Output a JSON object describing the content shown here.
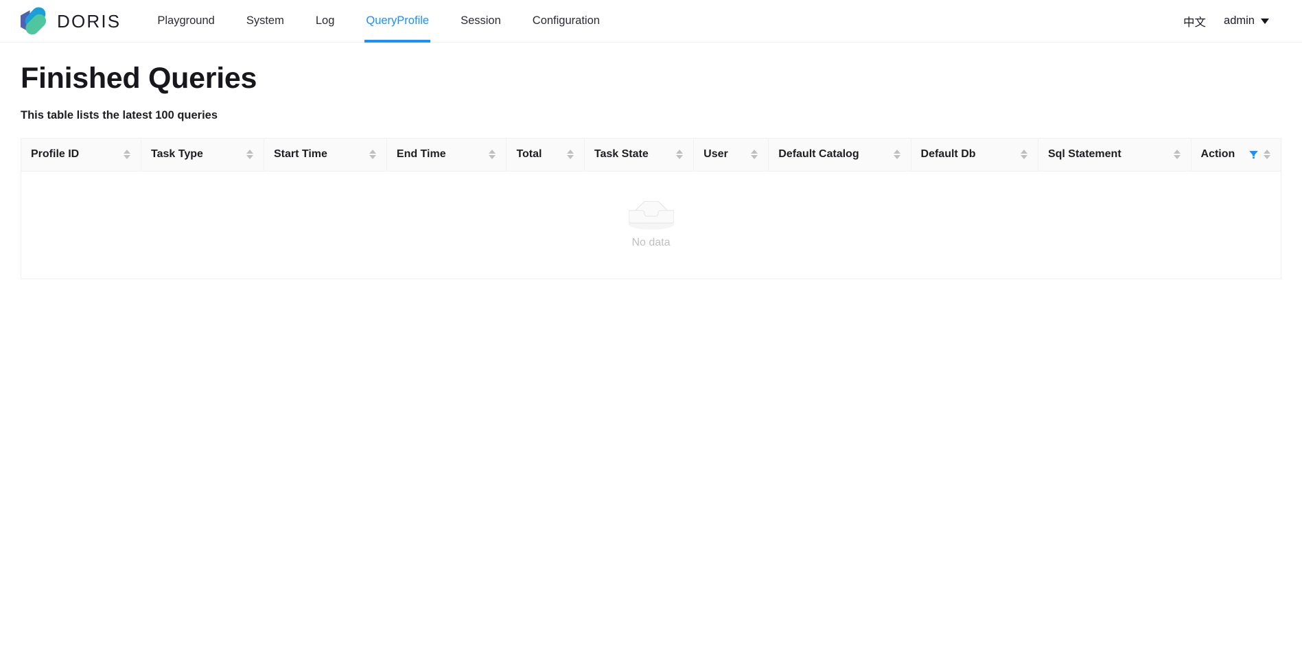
{
  "header": {
    "brand": {
      "name": "DORIS",
      "logo_icon": "doris-logo-icon"
    },
    "nav": [
      {
        "label": "Playground",
        "active": false
      },
      {
        "label": "System",
        "active": false
      },
      {
        "label": "Log",
        "active": false
      },
      {
        "label": "QueryProfile",
        "active": true
      },
      {
        "label": "Session",
        "active": false
      },
      {
        "label": "Configuration",
        "active": false
      }
    ],
    "language_toggle": "中文",
    "user": "admin",
    "user_caret_icon": "chevron-down-icon",
    "accent_color": "#1890ff"
  },
  "main": {
    "title": "Finished Queries",
    "subtitle": "This table lists the latest 100 queries",
    "table": {
      "columns": [
        {
          "label": "Profile ID",
          "sortable": true
        },
        {
          "label": "Task Type",
          "sortable": true
        },
        {
          "label": "Start Time",
          "sortable": true
        },
        {
          "label": "End Time",
          "sortable": true
        },
        {
          "label": "Total",
          "sortable": true
        },
        {
          "label": "Task State",
          "sortable": true
        },
        {
          "label": "User",
          "sortable": true
        },
        {
          "label": "Default Catalog",
          "sortable": true
        },
        {
          "label": "Default Db",
          "sortable": true
        },
        {
          "label": "Sql Statement",
          "sortable": true
        },
        {
          "label": "Action",
          "sortable": true,
          "filter_icon": "filter-funnel-icon"
        }
      ],
      "rows": [],
      "empty_text": "No data",
      "empty_icon": "empty-inbox-icon",
      "header_background": "#fafafa",
      "border_color": "#f0f0f0",
      "filter_icon_color": "#1890ff"
    }
  }
}
